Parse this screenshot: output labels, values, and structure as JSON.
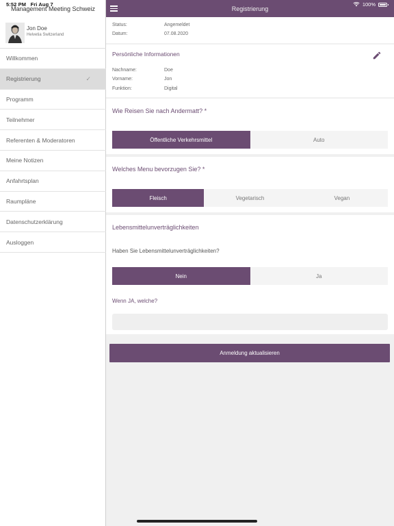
{
  "status_bar": {
    "time": "5:52 PM",
    "date": "Fri Aug 7",
    "battery": "100%"
  },
  "sidebar": {
    "title": "Management Meeting Schweiz",
    "profile": {
      "name": "Jon Doe",
      "organization": "Helvetia Switzerland"
    },
    "items": [
      {
        "label": "Willkommen"
      },
      {
        "label": "Registrierung",
        "active": true
      },
      {
        "label": "Programm"
      },
      {
        "label": "Teilnehmer"
      },
      {
        "label": "Referenten & Moderatoren"
      },
      {
        "label": "Meine Notizen"
      },
      {
        "label": "Anfahrtsplan"
      },
      {
        "label": "Raumpläne"
      },
      {
        "label": "Datenschutzerklärung"
      },
      {
        "label": "Ausloggen"
      }
    ],
    "check_glyph": "✓"
  },
  "header": {
    "title": "Registrierung"
  },
  "status_section": {
    "status_label": "Status:",
    "status_value": "Angemeldet",
    "date_label": "Datum:",
    "date_value": "07.08.2020"
  },
  "personal": {
    "title": "Persönliche Informationen",
    "lastname_label": "Nachname:",
    "lastname_value": "Doe",
    "firstname_label": "Vorname:",
    "firstname_value": "Jon",
    "function_label": "Funktion:",
    "function_value": "Digital"
  },
  "travel": {
    "question": "Wie Reisen Sie nach Andermatt? *",
    "options": [
      "Öffentliche Verkehrsmittel",
      "Auto"
    ],
    "selected": 0
  },
  "menu": {
    "question": "Welches Menu bevorzugen Sie? *",
    "options": [
      "Fleisch",
      "Vegetarisch",
      "Vegan"
    ],
    "selected": 0
  },
  "allergies": {
    "title": "Lebensmittelunverträglichkeiten",
    "question": "Haben Sie Lebensmittelunverträglichkeiten?",
    "options": [
      "Nein",
      "Ja"
    ],
    "selected": 0,
    "followup_label": "Wenn JA, welche?",
    "followup_value": ""
  },
  "submit_label": "Anmeldung aktualisieren",
  "colors": {
    "accent": "#6b4c72",
    "background": "#f0f0f0"
  }
}
